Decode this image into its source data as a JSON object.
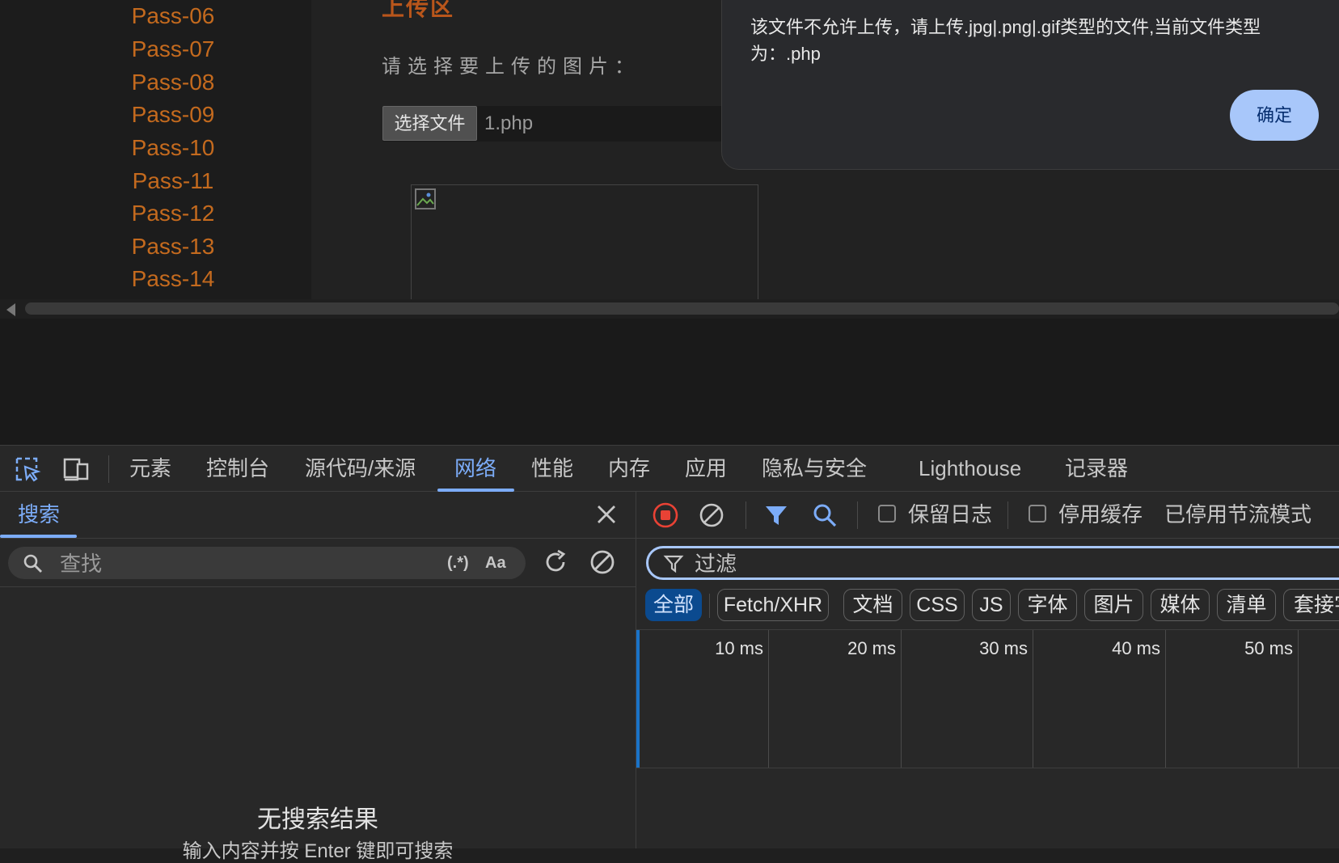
{
  "page": {
    "sidebar_links": [
      "Pass-06",
      "Pass-07",
      "Pass-08",
      "Pass-09",
      "Pass-10",
      "Pass-11",
      "Pass-12",
      "Pass-13",
      "Pass-14"
    ],
    "title": "上传区",
    "upload_prompt": "请选择要上传的图片：",
    "choose_file_label": "选择文件",
    "file_name": "1.php"
  },
  "alert": {
    "message": "该文件不允许上传，请上传.jpg|.png|.gif类型的文件,当前文件类型为：.php",
    "ok_label": "确定"
  },
  "devtools": {
    "tabs": [
      "元素",
      "控制台",
      "源代码/来源",
      "网络",
      "性能",
      "内存",
      "应用",
      "隐私与安全",
      "Lighthouse",
      "记录器"
    ],
    "active_tab": "网络",
    "search": {
      "tab_label": "搜索",
      "placeholder": "查找",
      "regex_label": "(.*)",
      "case_label": "Aa",
      "no_results": "无搜索结果",
      "hint": "输入内容并按 Enter 键即可搜索"
    },
    "network": {
      "preserve_log_label": "保留日志",
      "disable_cache_label": "停用缓存",
      "throttling_label": "已停用节流模式",
      "filter_placeholder": "过滤",
      "filter_chips": [
        "全部",
        "Fetch/XHR",
        "文档",
        "CSS",
        "JS",
        "字体",
        "图片",
        "媒体",
        "清单",
        "套接字"
      ],
      "active_chip": "全部",
      "timeline_labels": [
        "10 ms",
        "20 ms",
        "30 ms",
        "40 ms",
        "50 ms"
      ]
    },
    "colors": {
      "accent": "#7cacf8",
      "record_red": "#e94235"
    }
  }
}
